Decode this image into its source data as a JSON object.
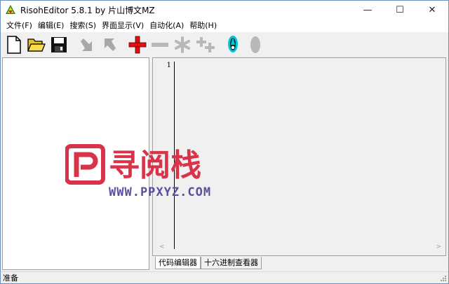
{
  "window": {
    "title": "RisohEditor 5.8.1 by 片山博文MZ",
    "controls": {
      "minimize": "—",
      "maximize": "☐",
      "close": "✕"
    }
  },
  "menubar": {
    "items": [
      {
        "label": "文件(F)"
      },
      {
        "label": "编辑(E)"
      },
      {
        "label": "搜索(S)"
      },
      {
        "label": "界面显示(V)"
      },
      {
        "label": "自动化(A)"
      },
      {
        "label": "帮助(H)"
      }
    ]
  },
  "toolbar": {
    "buttons": [
      {
        "icon": "new-file-icon",
        "enabled": true
      },
      {
        "icon": "open-folder-icon",
        "enabled": true
      },
      {
        "icon": "save-disk-icon",
        "enabled": true
      },
      {
        "icon": "import-arrow-icon",
        "enabled": false
      },
      {
        "icon": "export-arrow-icon",
        "enabled": false
      },
      {
        "icon": "add-plus-icon",
        "enabled": true,
        "color": "#e01010"
      },
      {
        "icon": "delete-minus-icon",
        "enabled": false
      },
      {
        "icon": "asterisk-icon",
        "enabled": false
      },
      {
        "icon": "cross-plus-icon",
        "enabled": false
      },
      {
        "icon": "compile-rocket-icon",
        "enabled": true,
        "color": "#00b8c8"
      },
      {
        "icon": "cancel-ellipse-icon",
        "enabled": false
      }
    ]
  },
  "editor": {
    "line_numbers": [
      "1"
    ],
    "tabs": [
      {
        "label": "代码编辑器",
        "active": true
      },
      {
        "label": "十六进制查看器",
        "active": false
      }
    ]
  },
  "statusbar": {
    "text": "准备"
  },
  "watermark": {
    "logo_letter": "P",
    "logo_text": "寻阅栈",
    "url": "WWW.PPXYZ.COM",
    "color": "#d9334a"
  }
}
